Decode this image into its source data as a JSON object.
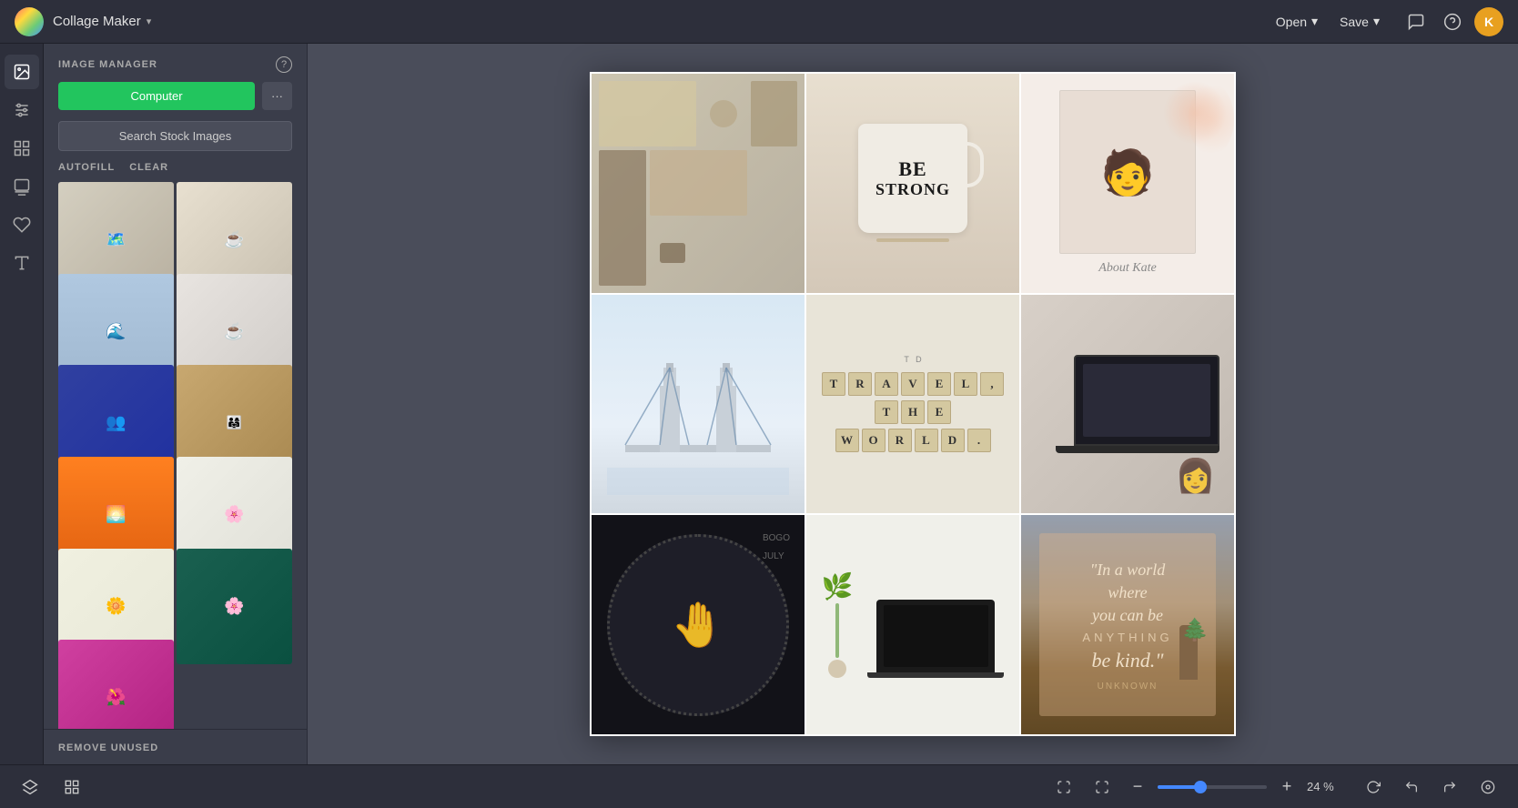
{
  "topbar": {
    "app_name": "Collage Maker",
    "chevron": "▾",
    "open_label": "Open",
    "save_label": "Save",
    "open_chevron": "▾",
    "save_chevron": "▾",
    "avatar_initials": "K"
  },
  "sidebar": {
    "title": "IMAGE MANAGER",
    "help_icon": "?",
    "computer_btn": "Computer",
    "more_btn": "···",
    "search_stock_btn": "Search Stock Images",
    "autofill_btn": "AUTOFILL",
    "clear_btn": "CLEAR",
    "remove_unused_btn": "REMOVE UNUSED"
  },
  "canvas": {
    "cells": [
      {
        "id": "cell-1",
        "type": "flatlay",
        "desc": "Map, tools, camera flatlay"
      },
      {
        "id": "cell-2",
        "type": "coffee",
        "desc": "Coffee mug be strong text"
      },
      {
        "id": "cell-3",
        "type": "portrait",
        "desc": "Woman portrait about kate"
      },
      {
        "id": "cell-4",
        "type": "bridge",
        "desc": "Tower Bridge London"
      },
      {
        "id": "cell-5",
        "type": "scrabble",
        "desc": "Travel the world scrabble tiles"
      },
      {
        "id": "cell-6",
        "type": "laptop-work",
        "desc": "Woman working on laptop"
      },
      {
        "id": "cell-7",
        "type": "perfume",
        "desc": "Hand holding perfume dark"
      },
      {
        "id": "cell-8",
        "type": "plant-laptop",
        "desc": "Plant and laptop minimal"
      },
      {
        "id": "cell-9",
        "type": "quote",
        "desc": "Be kind inspirational quote"
      }
    ],
    "scrabble_rows": [
      [
        "T",
        "R",
        "A",
        "V",
        "E",
        "L",
        ","
      ],
      [
        "T",
        "H",
        "E"
      ],
      [
        "W",
        "O",
        "R",
        "L",
        "D",
        "."
      ]
    ],
    "coffee_text": "BE\nSTRONG",
    "quote_main": "\"In a world\nwhere\nyou can be\n",
    "quote_anything": "ANYTHING",
    "quote_end": "\nbe kind.\"",
    "quote_sub": "UNKNOWN",
    "portrait_caption": "About Kate"
  },
  "bottombar": {
    "zoom_minus": "−",
    "zoom_plus": "+",
    "zoom_percent": "24 %",
    "zoom_value": 24
  }
}
